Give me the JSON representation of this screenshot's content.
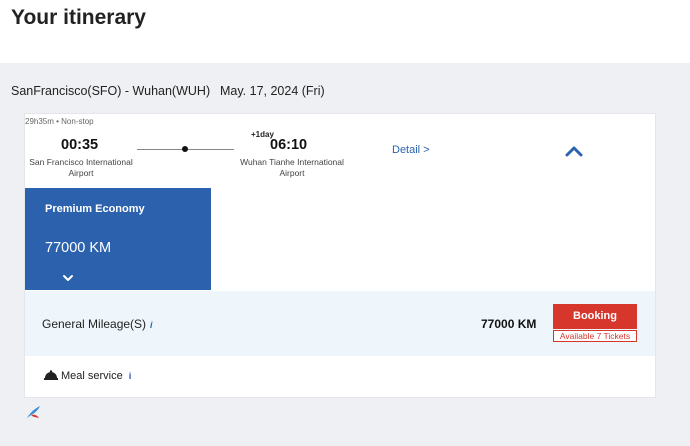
{
  "page_title": "Your itinerary",
  "route": {
    "label": "SanFrancisco(SFO) - Wuhan(WUH)",
    "date": "May. 17, 2024 (Fri)"
  },
  "flight": {
    "duration": "29h35m • Non-stop",
    "departure": {
      "time": "00:35",
      "airport": "San Francisco International Airport"
    },
    "arrival": {
      "time": "06:10",
      "day_offset": "+1day",
      "airport": "Wuhan Tianhe International Airport"
    },
    "detail_link": "Detail >"
  },
  "cabin": {
    "name": "Premium Economy",
    "price": "77000 KM"
  },
  "fare": {
    "label": "General Mileage(S)",
    "info": "i",
    "amount": "77000 KM",
    "booking_label": "Booking",
    "availability": "Available 7 Tickets"
  },
  "services": {
    "meal_label": "Meal service",
    "meal_info": "i"
  },
  "colors": {
    "accent_blue": "#2c62ad",
    "booking_red": "#d7362c",
    "fare_row_bg": "#eef6fb",
    "section_bg": "#eef0f3"
  },
  "icons": {
    "collapse": "chevron-up-icon",
    "expand": "chevron-down-icon",
    "meal": "meal-icon",
    "info": "info-icon",
    "airline": "airline-logo"
  }
}
